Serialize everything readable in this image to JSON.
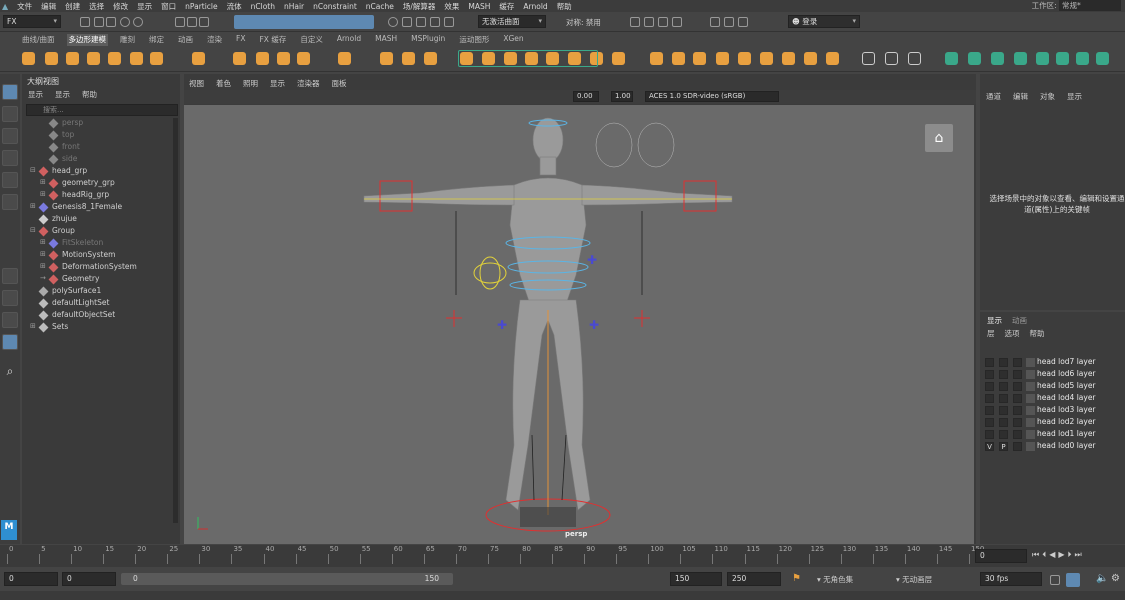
{
  "menubar": {
    "items": [
      "文件",
      "编辑",
      "创建",
      "选择",
      "修改",
      "显示",
      "窗口",
      "nParticle",
      "流体",
      "nCloth",
      "nHair",
      "nConstraint",
      "nCache",
      "场/解算器",
      "效果",
      "MASH",
      "缓存",
      "Arnold",
      "帮助"
    ],
    "workspace_label": "工作区:",
    "workspace_value": "常规*"
  },
  "statusline": {
    "mode": "FX",
    "live_surface": "无激活曲面",
    "symmetry": "对称: 禁用",
    "login": "登录"
  },
  "shelf_tabs": [
    "曲线/曲面",
    "多边形建模",
    "雕刻",
    "绑定",
    "动画",
    "渲染",
    "FX",
    "FX 缓存",
    "自定义",
    "Arnold",
    "MASH",
    "MSPlugin",
    "运动图形",
    "XGen"
  ],
  "shelf_active_tab": "多边形建模",
  "outliner": {
    "title": "大纲视图",
    "menu": [
      "显示",
      "显示",
      "帮助"
    ],
    "search_placeholder": "搜索...",
    "rows": [
      {
        "label": "persp",
        "dim": true,
        "indent": 1,
        "expand": "",
        "icon": "camera-icon"
      },
      {
        "label": "top",
        "dim": true,
        "indent": 1,
        "expand": "",
        "icon": "camera-icon"
      },
      {
        "label": "front",
        "dim": true,
        "indent": 1,
        "expand": "",
        "icon": "camera-icon"
      },
      {
        "label": "side",
        "dim": true,
        "indent": 1,
        "expand": "",
        "icon": "camera-icon"
      },
      {
        "label": "head_grp",
        "dim": false,
        "indent": 0,
        "expand": "⊟",
        "icon": "group-icon"
      },
      {
        "label": "geometry_grp",
        "dim": false,
        "indent": 1,
        "expand": "⊞",
        "icon": "group-icon"
      },
      {
        "label": "headRig_grp",
        "dim": false,
        "indent": 1,
        "expand": "⊞",
        "icon": "group-icon"
      },
      {
        "label": "Genesis8_1Female",
        "dim": false,
        "indent": 0,
        "expand": "⊞",
        "icon": "joint-icon"
      },
      {
        "label": "zhujue",
        "dim": false,
        "indent": 0,
        "expand": "",
        "icon": "locator-icon"
      },
      {
        "label": "Group",
        "dim": false,
        "indent": 0,
        "expand": "⊟",
        "icon": "group-icon"
      },
      {
        "label": "FitSkeleton",
        "dim": true,
        "indent": 1,
        "expand": "⊞",
        "icon": "joint-icon"
      },
      {
        "label": "MotionSystem",
        "dim": false,
        "indent": 1,
        "expand": "⊞",
        "icon": "group-icon"
      },
      {
        "label": "DeformationSystem",
        "dim": false,
        "indent": 1,
        "expand": "⊞",
        "icon": "group-icon"
      },
      {
        "label": "Geometry",
        "dim": false,
        "indent": 1,
        "expand": "→",
        "icon": "group-icon"
      },
      {
        "label": "polySurface1",
        "dim": false,
        "indent": 0,
        "expand": "",
        "icon": "mesh-icon"
      },
      {
        "label": "defaultLightSet",
        "dim": false,
        "indent": 0,
        "expand": "",
        "icon": "set-icon"
      },
      {
        "label": "defaultObjectSet",
        "dim": false,
        "indent": 0,
        "expand": "",
        "icon": "set-icon"
      },
      {
        "label": "Sets",
        "dim": false,
        "indent": 0,
        "expand": "⊞",
        "icon": "set-icon"
      }
    ]
  },
  "viewport": {
    "menu": [
      "视图",
      "着色",
      "照明",
      "显示",
      "渲染器",
      "面板"
    ],
    "field_a": "0.00",
    "field_b": "1.00",
    "colorspace": "ACES 1.0 SDR-video (sRGB)",
    "camera": "persp"
  },
  "attribute_editor": {
    "menu": [
      "通道",
      "编辑",
      "对象",
      "显示"
    ],
    "message": "选择场景中的对象以查看、编辑和设置通道(属性)上的关键帧"
  },
  "layer_editor": {
    "tabs": [
      "显示",
      "动画"
    ],
    "menu": [
      "层",
      "选项",
      "帮助"
    ],
    "layers": [
      {
        "name": "head lod7 layer",
        "v": "",
        "p": ""
      },
      {
        "name": "head lod6 layer",
        "v": "",
        "p": ""
      },
      {
        "name": "head lod5 layer",
        "v": "",
        "p": ""
      },
      {
        "name": "head lod4 layer",
        "v": "",
        "p": ""
      },
      {
        "name": "head lod3 layer",
        "v": "",
        "p": ""
      },
      {
        "name": "head lod2 layer",
        "v": "",
        "p": ""
      },
      {
        "name": "head lod1 layer",
        "v": "",
        "p": ""
      },
      {
        "name": "head lod0 layer",
        "v": "V",
        "p": "P"
      }
    ]
  },
  "timeline": {
    "ticks": [
      "0",
      "5",
      "10",
      "15",
      "20",
      "25",
      "30",
      "35",
      "40",
      "45",
      "50",
      "55",
      "60",
      "65",
      "70",
      "75",
      "80",
      "85",
      "90",
      "95",
      "100",
      "105",
      "110",
      "115",
      "120",
      "125",
      "130",
      "135",
      "140",
      "145",
      "150"
    ],
    "current_frame": "0"
  },
  "range": {
    "start": "0",
    "anim_start": "0",
    "range_start": "0",
    "range_end": "150",
    "end": "150",
    "anim_end": "250",
    "character_set": "无角色集",
    "anim_layer": "无动画层",
    "fps": "30 fps"
  },
  "colors": {
    "accent_orange": "#e8a040",
    "shelf_teal": "#3aa88a",
    "highlight_blue": "#5e89b2"
  }
}
